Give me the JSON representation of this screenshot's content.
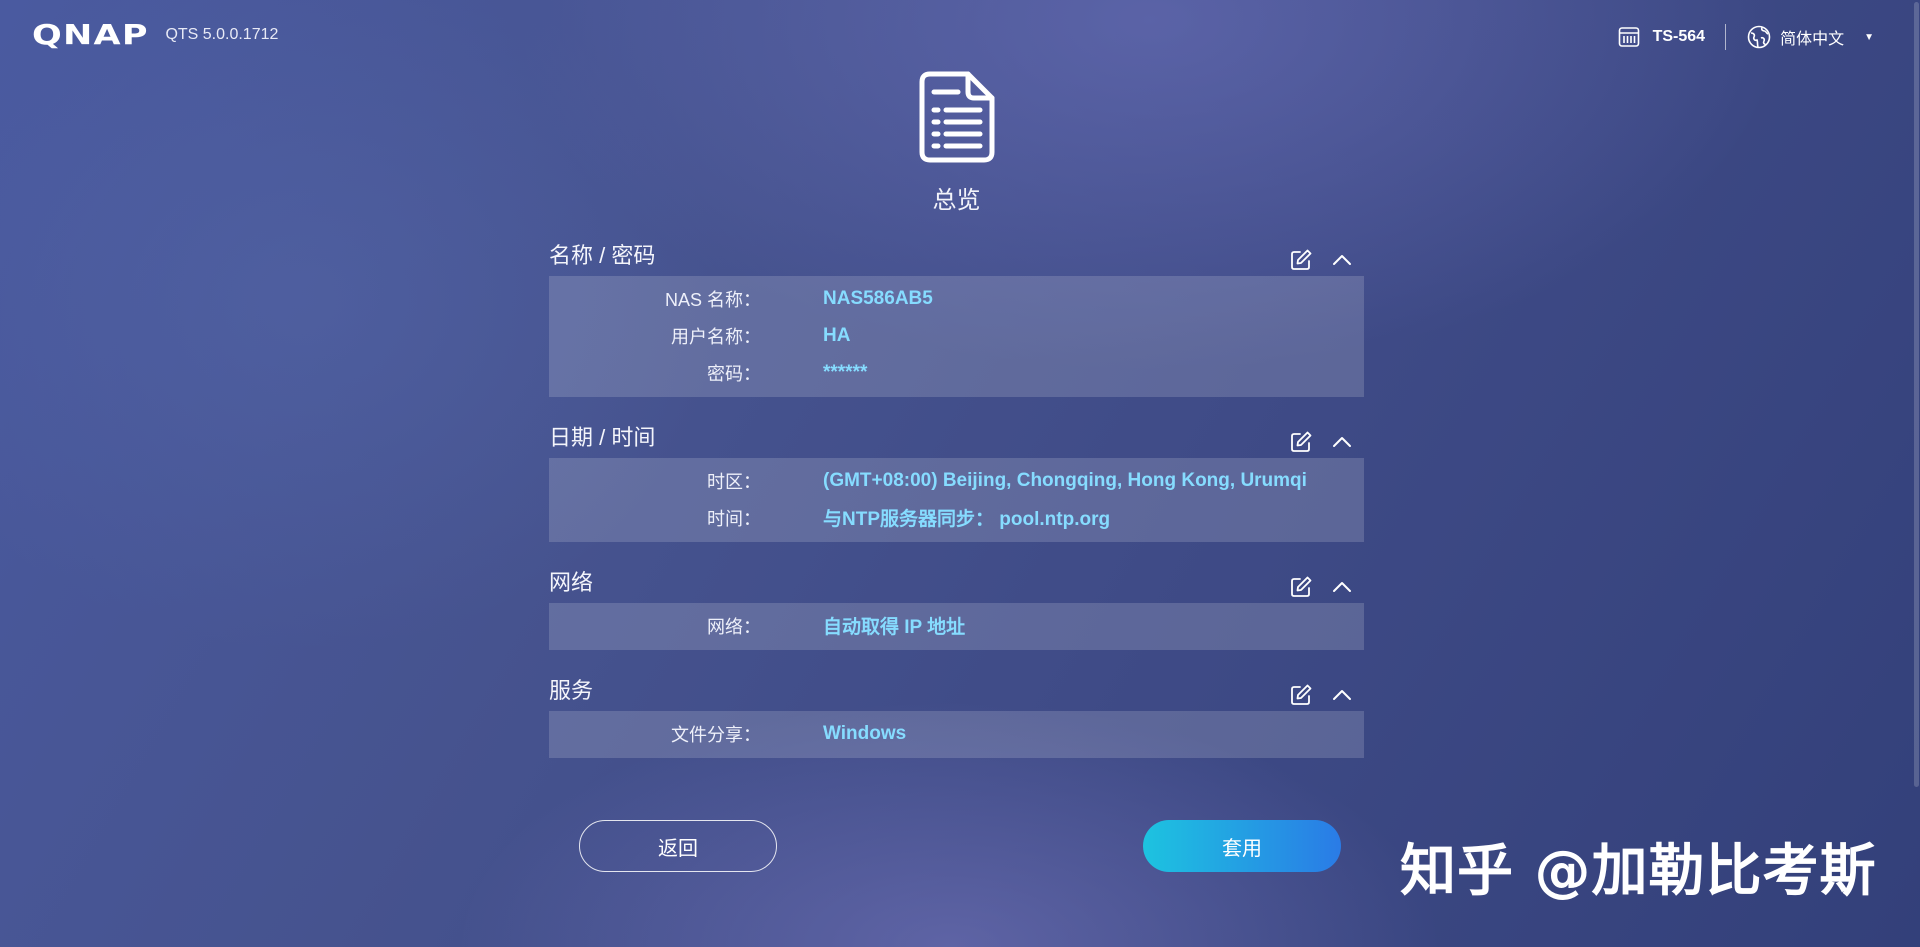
{
  "app": {
    "brand": "QNAP",
    "version": "QTS 5.0.0.1712"
  },
  "topbar": {
    "model": "TS-564",
    "language": "简体中文",
    "icons": {
      "model": "nas-device-icon",
      "language": "globe-icon",
      "dropdown": "caret-down-icon"
    }
  },
  "page": {
    "title": "总览",
    "icon": "document-list-icon"
  },
  "sections": {
    "name_password": {
      "title": "名称 / 密码",
      "rows": [
        {
          "label": "NAS 名称：",
          "value": "NAS586AB5"
        },
        {
          "label": "用户名称：",
          "value": "HA"
        },
        {
          "label": "密码：",
          "value": "******"
        }
      ]
    },
    "date_time": {
      "title": "日期 / 时间",
      "rows": [
        {
          "label": "时区：",
          "value": "(GMT+08:00) Beijing, Chongqing, Hong Kong, Urumqi"
        },
        {
          "label": "时间：",
          "value": "与NTP服务器同步： pool.ntp.org"
        }
      ]
    },
    "network": {
      "title": "网络",
      "rows": [
        {
          "label": "网络：",
          "value": "自动取得 IP 地址"
        }
      ]
    },
    "services": {
      "title": "服务",
      "rows": [
        {
          "label": "文件分享：",
          "value": "Windows"
        }
      ]
    }
  },
  "buttons": {
    "back": "返回",
    "apply": "套用"
  },
  "watermark": "知乎 @加勒比考斯",
  "colors": {
    "value_text": "#86dcff",
    "apply_gradient_start": "#1dc3e0",
    "apply_gradient_end": "#2a7be6",
    "background": "#4a5aa0"
  }
}
